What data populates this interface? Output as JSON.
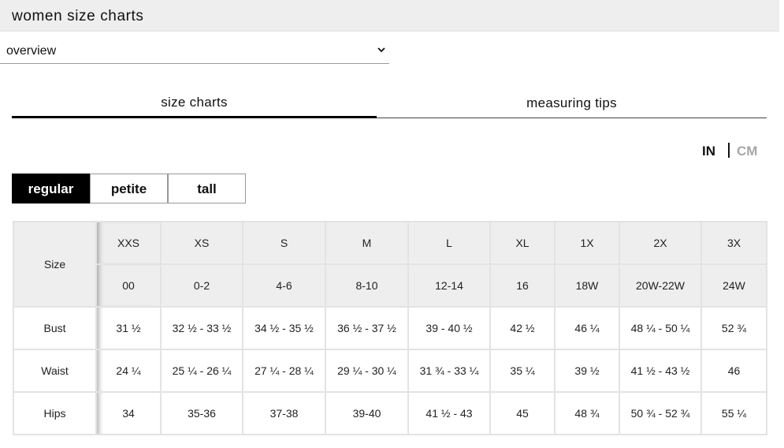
{
  "header": {
    "title": "women size charts"
  },
  "dropdown": {
    "selected": "overview"
  },
  "tabs": [
    {
      "label": "size charts",
      "active": true
    },
    {
      "label": "measuring tips",
      "active": false
    }
  ],
  "units": {
    "in": "IN",
    "cm": "CM",
    "selected": "IN"
  },
  "fit": {
    "options": [
      "regular",
      "petite",
      "tall"
    ],
    "selected": "regular"
  },
  "table": {
    "size_label": "Size",
    "sizes": [
      "XXS",
      "XS",
      "S",
      "M",
      "L",
      "XL",
      "1X",
      "2X",
      "3X"
    ],
    "numeric": [
      "00",
      "0-2",
      "4-6",
      "8-10",
      "12-14",
      "16",
      "18W",
      "20W-22W",
      "24W"
    ],
    "rows": [
      {
        "label": "Bust",
        "values": [
          "31 ½",
          "32 ½ - 33 ½",
          "34 ½ - 35 ½",
          "36 ½ - 37 ½",
          "39 - 40 ½",
          "42 ½",
          "46 ¼",
          "48 ¼ - 50 ¼",
          "52 ¾"
        ]
      },
      {
        "label": "Waist",
        "values": [
          "24 ¼",
          "25 ¼ - 26 ¼",
          "27 ¼ - 28 ¼",
          "29 ¼ - 30 ¼",
          "31 ¾ - 33 ¼",
          "35 ¼",
          "39 ½",
          "41 ½ - 43 ½",
          "46"
        ]
      },
      {
        "label": "Hips",
        "values": [
          "34",
          "35-36",
          "37-38",
          "39-40",
          "41 ½ - 43",
          "45",
          "48 ¾",
          "50 ¾ - 52 ¾",
          "55 ¼"
        ]
      }
    ]
  },
  "colors": {
    "accent": "#000000",
    "header_bg": "#eeeeee",
    "inactive_unit": "#a6a6a6",
    "border": "#e3e3e3"
  }
}
